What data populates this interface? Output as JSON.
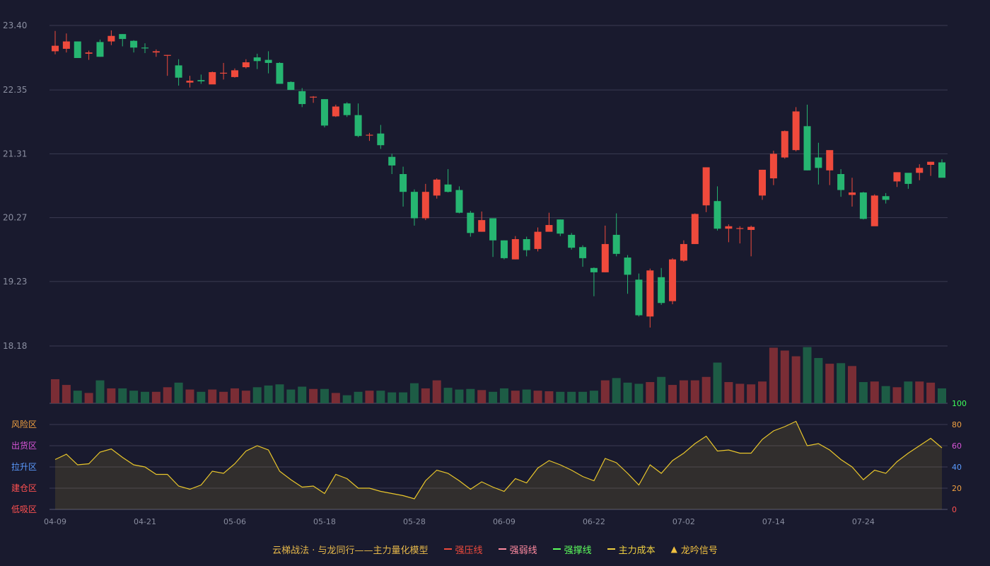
{
  "chart_data": {
    "type": "candlestick",
    "price_axis": {
      "ticks": [
        "23.40",
        "22.35",
        "21.31",
        "20.27",
        "19.23",
        "18.18"
      ],
      "min": 18.18,
      "max": 23.4
    },
    "x_tick_labels": [
      "04-09",
      "04-21",
      "05-06",
      "05-18",
      "05-28",
      "06-09",
      "06-22",
      "07-02",
      "07-14",
      "07-24"
    ],
    "x_tick_index": [
      0,
      8,
      16,
      24,
      32,
      40,
      48,
      56,
      64,
      72
    ],
    "candles": [
      [
        22.98,
        23.07,
        22.93,
        23.31
      ],
      [
        23.02,
        23.14,
        22.96,
        23.27
      ],
      [
        23.14,
        22.87,
        22.87,
        23.14
      ],
      [
        22.94,
        22.96,
        22.84,
        22.99
      ],
      [
        23.13,
        22.89,
        22.89,
        23.17
      ],
      [
        23.14,
        23.23,
        23.08,
        23.32
      ],
      [
        23.26,
        23.18,
        23.06,
        23.26
      ],
      [
        23.15,
        23.04,
        22.96,
        23.16
      ],
      [
        23.04,
        23.03,
        22.95,
        23.11
      ],
      [
        22.96,
        22.98,
        22.89,
        23.01
      ],
      [
        22.92,
        22.92,
        22.58,
        22.92
      ],
      [
        22.75,
        22.55,
        22.42,
        22.85
      ],
      [
        22.47,
        22.5,
        22.39,
        22.58
      ],
      [
        22.51,
        22.49,
        22.45,
        22.6
      ],
      [
        22.44,
        22.64,
        22.45,
        22.65
      ],
      [
        22.62,
        22.63,
        22.52,
        22.79
      ],
      [
        22.56,
        22.67,
        22.55,
        22.7
      ],
      [
        22.72,
        22.8,
        22.7,
        22.85
      ],
      [
        22.88,
        22.82,
        22.69,
        22.94
      ],
      [
        22.84,
        22.79,
        22.62,
        22.98
      ],
      [
        22.79,
        22.45,
        22.45,
        22.8
      ],
      [
        22.48,
        22.35,
        22.35,
        22.49
      ],
      [
        22.33,
        22.12,
        22.07,
        22.38
      ],
      [
        22.24,
        22.24,
        22.14,
        22.25
      ],
      [
        22.2,
        21.77,
        21.74,
        22.2
      ],
      [
        21.92,
        22.08,
        21.91,
        22.11
      ],
      [
        22.13,
        21.94,
        21.91,
        22.15
      ],
      [
        21.94,
        21.6,
        21.58,
        22.13
      ],
      [
        21.62,
        21.62,
        21.52,
        21.65
      ],
      [
        21.64,
        21.45,
        21.39,
        21.78
      ],
      [
        21.26,
        21.12,
        20.98,
        21.31
      ],
      [
        20.98,
        20.69,
        20.45,
        21.1
      ],
      [
        20.69,
        20.26,
        20.14,
        20.73
      ],
      [
        20.26,
        20.69,
        20.23,
        20.82
      ],
      [
        20.63,
        20.89,
        20.58,
        20.91
      ],
      [
        20.81,
        20.69,
        20.68,
        21.06
      ],
      [
        20.72,
        20.35,
        20.34,
        20.78
      ],
      [
        20.35,
        20.02,
        19.96,
        20.38
      ],
      [
        20.04,
        20.23,
        20.04,
        20.37
      ],
      [
        20.26,
        19.9,
        19.63,
        20.26
      ],
      [
        19.9,
        19.61,
        19.59,
        19.9
      ],
      [
        19.59,
        19.92,
        19.59,
        19.97
      ],
      [
        19.92,
        19.74,
        19.64,
        19.96
      ],
      [
        19.76,
        20.04,
        19.72,
        20.11
      ],
      [
        20.04,
        20.15,
        20.06,
        20.35
      ],
      [
        20.24,
        20.01,
        19.97,
        20.24
      ],
      [
        19.99,
        19.78,
        19.75,
        20.02
      ],
      [
        19.79,
        19.61,
        19.47,
        19.82
      ],
      [
        19.45,
        19.38,
        18.99,
        19.46
      ],
      [
        19.38,
        19.84,
        19.38,
        20.14
      ],
      [
        19.99,
        19.68,
        19.64,
        20.34
      ],
      [
        19.62,
        19.34,
        19.03,
        19.66
      ],
      [
        19.26,
        18.68,
        18.66,
        19.36
      ],
      [
        18.66,
        19.41,
        18.48,
        19.44
      ],
      [
        19.3,
        18.88,
        18.85,
        19.45
      ],
      [
        18.91,
        19.59,
        18.86,
        19.61
      ],
      [
        19.57,
        19.84,
        19.55,
        19.9
      ],
      [
        19.84,
        20.33,
        19.84,
        20.34
      ],
      [
        20.47,
        21.09,
        20.36,
        21.09
      ],
      [
        20.54,
        20.09,
        20.06,
        20.78
      ],
      [
        20.09,
        20.13,
        19.87,
        20.16
      ],
      [
        20.1,
        20.1,
        19.85,
        20.13
      ],
      [
        20.07,
        20.12,
        19.64,
        20.14
      ],
      [
        20.63,
        21.05,
        20.56,
        21.05
      ],
      [
        20.91,
        21.31,
        20.8,
        21.36
      ],
      [
        21.25,
        21.68,
        21.23,
        21.69
      ],
      [
        21.37,
        22.0,
        21.35,
        22.07
      ],
      [
        21.76,
        21.04,
        21.04,
        22.11
      ],
      [
        21.25,
        21.08,
        20.81,
        21.49
      ],
      [
        21.04,
        21.37,
        20.8,
        21.35
      ],
      [
        20.98,
        20.72,
        20.61,
        21.06
      ],
      [
        20.64,
        20.68,
        20.45,
        20.92
      ],
      [
        20.68,
        20.25,
        20.24,
        20.69
      ],
      [
        20.13,
        20.63,
        20.14,
        20.65
      ],
      [
        20.62,
        20.56,
        20.5,
        20.67
      ],
      [
        20.86,
        21.01,
        20.77,
        21.01
      ],
      [
        21.0,
        20.82,
        20.74,
        20.99
      ],
      [
        21.0,
        21.08,
        20.88,
        21.14
      ],
      [
        21.13,
        21.18,
        20.95,
        21.18
      ],
      [
        21.17,
        20.92,
        20.94,
        21.22
      ]
    ],
    "volume": [
      0.42,
      0.32,
      0.22,
      0.18,
      0.4,
      0.26,
      0.26,
      0.22,
      0.2,
      0.2,
      0.28,
      0.36,
      0.24,
      0.2,
      0.24,
      0.2,
      0.26,
      0.22,
      0.28,
      0.31,
      0.33,
      0.24,
      0.29,
      0.25,
      0.25,
      0.18,
      0.14,
      0.2,
      0.22,
      0.22,
      0.19,
      0.19,
      0.35,
      0.26,
      0.4,
      0.27,
      0.24,
      0.25,
      0.23,
      0.2,
      0.26,
      0.22,
      0.24,
      0.22,
      0.21,
      0.2,
      0.2,
      0.2,
      0.22,
      0.4,
      0.44,
      0.36,
      0.34,
      0.37,
      0.46,
      0.32,
      0.4,
      0.4,
      0.46,
      0.71,
      0.37,
      0.34,
      0.33,
      0.38,
      0.97,
      0.92,
      0.82,
      0.98,
      0.79,
      0.69,
      0.7,
      0.65,
      0.37,
      0.38,
      0.3,
      0.28,
      0.38,
      0.38,
      0.36,
      0.26,
      0.32
    ],
    "indicator": {
      "name": "主力量化模型",
      "ylim": [
        0,
        100
      ],
      "right_ticks": [
        "100",
        "80",
        "60",
        "40",
        "20",
        "0"
      ],
      "zones": [
        "风险区",
        "出货区",
        "拉升区",
        "建仓区",
        "低吸区"
      ],
      "values": [
        47,
        52,
        42,
        43,
        54,
        57,
        49,
        42,
        40,
        33,
        33,
        22,
        19,
        23,
        36,
        34,
        43,
        55,
        60,
        56,
        36,
        28,
        21,
        22,
        15,
        33,
        29,
        20,
        20,
        17,
        15,
        13,
        10,
        27,
        37,
        34,
        27,
        19,
        26,
        21,
        17,
        29,
        25,
        39,
        46,
        42,
        37,
        31,
        27,
        48,
        44,
        34,
        23,
        42,
        34,
        46,
        53,
        62,
        69,
        55,
        56,
        53,
        53,
        66,
        74,
        78,
        83,
        60,
        62,
        56,
        47,
        40,
        28,
        37,
        34,
        45,
        53,
        60,
        67,
        58
      ]
    },
    "legend": {
      "title": "云梯战法 · 与龙同行——主力量化模型",
      "items": [
        {
          "label": "强压线",
          "color": "#ef4a3c",
          "style": "solid"
        },
        {
          "label": "强弱线",
          "color": "#ff8aa0",
          "style": "dashed"
        },
        {
          "label": "强撑线",
          "color": "#5cff5c",
          "style": "solid"
        },
        {
          "label": "主力成本",
          "color": "#f0d040",
          "style": "dashed"
        },
        {
          "label": "龙吟信号",
          "color": "#f0c040",
          "style": "triangle"
        }
      ]
    },
    "colors": {
      "up": "#ef4a3c",
      "down": "#26b571",
      "line": "#e9c62b",
      "grid": "#3a3b52",
      "axis_text": "#8a8ea0"
    }
  }
}
